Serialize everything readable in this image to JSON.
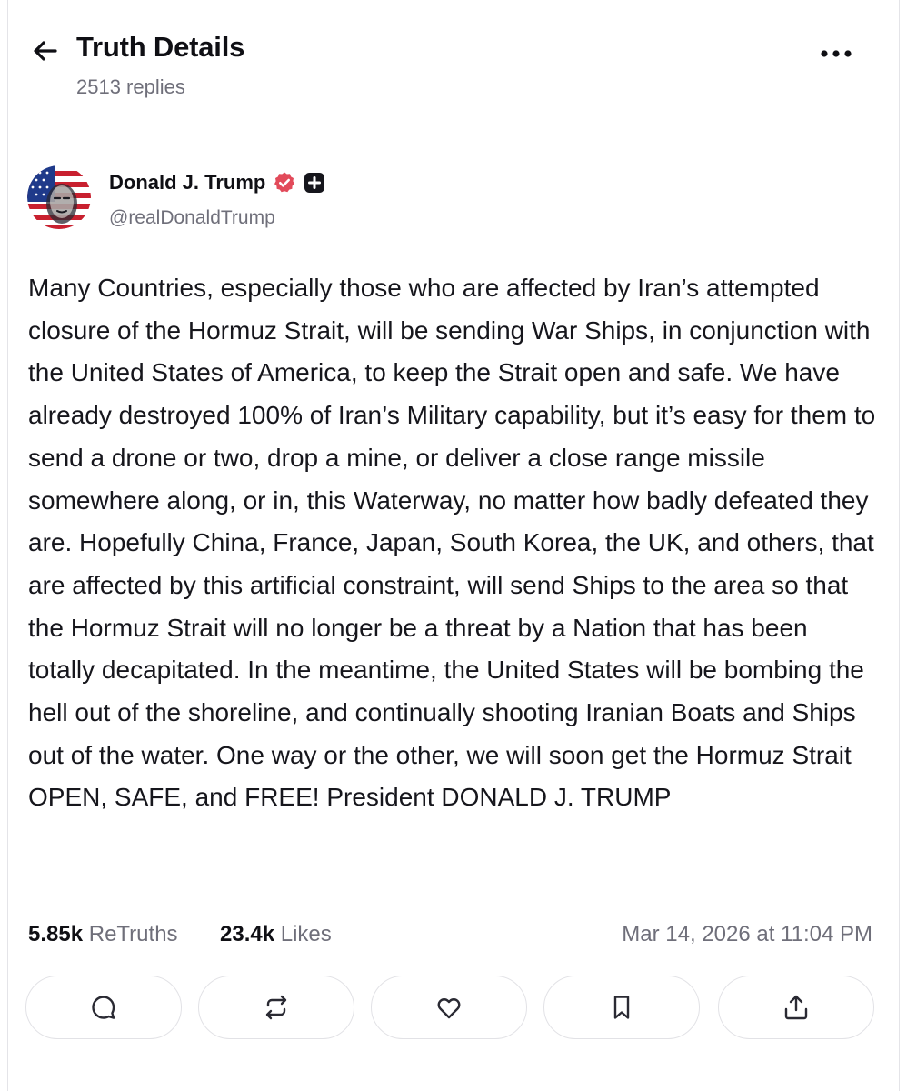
{
  "header": {
    "title": "Truth Details",
    "replies": "2513 replies",
    "back_icon": "arrow-left-icon",
    "more_icon": "more-horizontal-icon"
  },
  "author": {
    "name": "Donald J. Trump",
    "handle": "@realDonaldTrump",
    "verified_color": "#e24a5a"
  },
  "post": {
    "text": "Many Countries, especially those who are affected by Iran’s attempted closure of the Hormuz Strait, will be sending War Ships, in conjunction with the United States of America, to keep the Strait open and safe. We have already destroyed 100% of Iran’s Military capability, but it’s easy for them to send a drone or two, drop a mine, or deliver a close range missile somewhere along, or in, this Waterway, no matter how badly defeated they are. Hopefully China, France, Japan, South Korea, the UK, and others, that are affected by this artificial constraint, will send Ships to the area so that the Hormuz Strait will no longer be a threat by a Nation that has been totally decapitated. In the meantime, the United States will be bombing the hell out of the shoreline, and continually shooting Iranian Boats and Ships out of the water. One way or the other, we will soon get the Hormuz Strait OPEN, SAFE, and FREE! President DONALD J. TRUMP"
  },
  "stats": {
    "retruths_count": "5.85k",
    "retruths_label": "ReTruths",
    "likes_count": "23.4k",
    "likes_label": "Likes",
    "timestamp": "Mar 14, 2026 at 11:04 PM"
  },
  "actions": [
    {
      "icon": "reply-icon"
    },
    {
      "icon": "retruth-icon"
    },
    {
      "icon": "like-icon"
    },
    {
      "icon": "bookmark-icon"
    },
    {
      "icon": "share-icon"
    }
  ]
}
